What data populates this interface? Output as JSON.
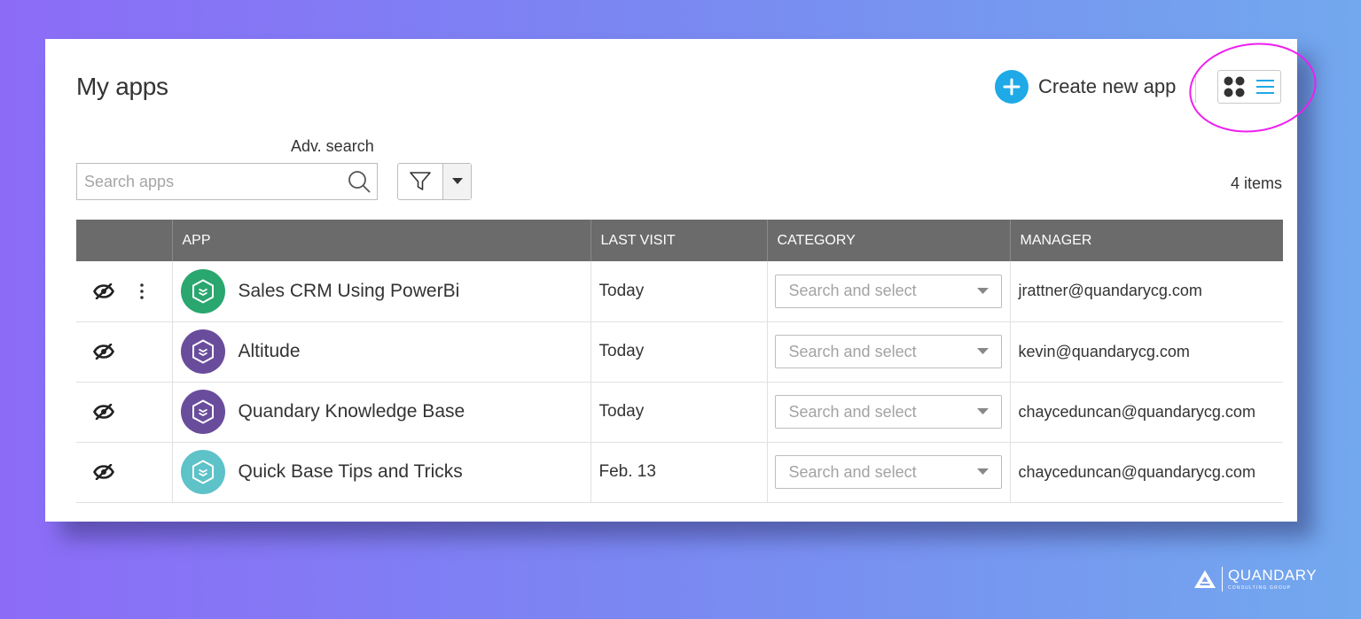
{
  "page": {
    "title": "My apps"
  },
  "toolbar": {
    "create_label": "Create new app",
    "adv_search_label": "Adv. search",
    "search_placeholder": "Search apps",
    "items_count": "4 items"
  },
  "colors": {
    "accent": "#1fa9e6",
    "highlight": "#ee1ff0",
    "header_bg": "#6b6b6b"
  },
  "table": {
    "columns": [
      "",
      "APP",
      "LAST VISIT",
      "CATEGORY",
      "MANAGER"
    ],
    "category_placeholder": "Search and select",
    "rows": [
      {
        "name": "Sales CRM Using PowerBi",
        "last_visit": "Today",
        "manager": "jrattner@quandarycg.com",
        "icon_color": "#2aa66f"
      },
      {
        "name": "Altitude",
        "last_visit": "Today",
        "manager": "kevin@quandarycg.com",
        "icon_color": "#6a4c9c"
      },
      {
        "name": "Quandary Knowledge Base",
        "last_visit": "Today",
        "manager": "chayceduncan@quandarycg.com",
        "icon_color": "#6a4c9c"
      },
      {
        "name": "Quick Base Tips and Tricks",
        "last_visit": "Feb. 13",
        "manager": "chayceduncan@quandarycg.com",
        "icon_color": "#5ec2c9"
      }
    ]
  },
  "footer": {
    "logo_name": "QUANDARY",
    "logo_sub": "CONSULTING GROUP"
  }
}
